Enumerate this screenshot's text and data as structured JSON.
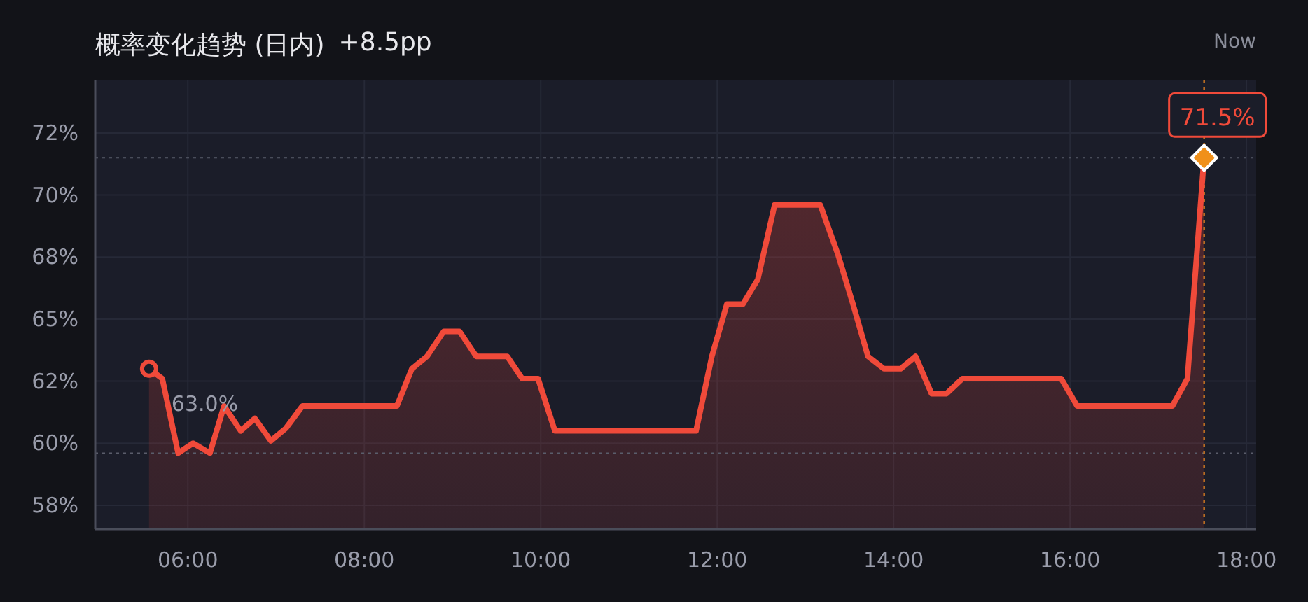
{
  "header": {
    "title": "概率变化趋势 (日内)",
    "change": "+8.5pp",
    "now_label": "Now"
  },
  "chart": {
    "chart_data": {
      "type": "area",
      "x": [
        5.56,
        5.71,
        5.89,
        6.06,
        6.25,
        6.41,
        6.6,
        6.76,
        6.94,
        7.11,
        7.3,
        8.37,
        8.54,
        8.71,
        8.9,
        9.08,
        9.27,
        9.62,
        9.79,
        9.97,
        10.16,
        11.76,
        11.94,
        12.11,
        12.29,
        12.46,
        12.65,
        13.17,
        13.37,
        13.54,
        13.71,
        13.89,
        14.08,
        14.25,
        14.43,
        14.6,
        14.78,
        15.9,
        16.08,
        17.16,
        17.33,
        17.52
      ],
      "values": [
        63.0,
        62.6,
        59.6,
        60.0,
        59.6,
        61.5,
        60.5,
        61.0,
        60.1,
        60.6,
        61.5,
        61.5,
        63.0,
        63.5,
        64.5,
        64.5,
        63.5,
        63.5,
        62.6,
        62.6,
        60.5,
        60.5,
        63.5,
        65.6,
        65.6,
        66.6,
        69.6,
        69.6,
        67.6,
        65.6,
        63.5,
        63.0,
        63.0,
        63.5,
        62.0,
        62.0,
        62.6,
        62.6,
        61.5,
        61.5,
        62.6,
        71.5
      ],
      "xlim": [
        4.95,
        18.11
      ],
      "ylim": [
        56.54,
        74.64
      ],
      "xticks": [
        {
          "value": 6,
          "label": "06:00"
        },
        {
          "value": 8,
          "label": "08:00"
        },
        {
          "value": 10,
          "label": "10:00"
        },
        {
          "value": 12,
          "label": "12:00"
        },
        {
          "value": 14,
          "label": "14:00"
        },
        {
          "value": 16,
          "label": "16:00"
        },
        {
          "value": 18,
          "label": "18:00"
        }
      ],
      "yticks": [
        {
          "value": 57.5,
          "label": "58%"
        },
        {
          "value": 60,
          "label": "60%"
        },
        {
          "value": 62.5,
          "label": "62%"
        },
        {
          "value": 65,
          "label": "65%"
        },
        {
          "value": 67.5,
          "label": "68%"
        },
        {
          "value": 70,
          "label": "70%"
        },
        {
          "value": 72.5,
          "label": "72%"
        }
      ],
      "grid": true,
      "ref_lines": [
        {
          "axis": "y",
          "value": 71.5
        },
        {
          "axis": "y",
          "value": 59.6
        },
        {
          "axis": "x",
          "value": 17.52
        }
      ],
      "annotations": [
        {
          "x": 5.56,
          "y": 63.0,
          "text": "63.0%"
        },
        {
          "x": 17.52,
          "y": 71.5,
          "text": "71.5%"
        }
      ]
    }
  }
}
